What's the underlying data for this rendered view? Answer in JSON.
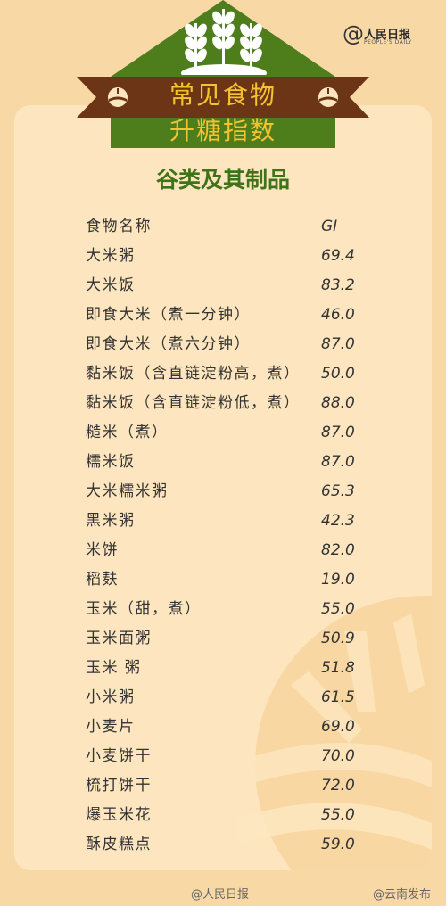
{
  "header": {
    "title_line1": "常见食物",
    "title_line2": "升糖指数"
  },
  "brand": {
    "at": "@",
    "name": "人民日报",
    "sub": "PEOPLE'S DAILY"
  },
  "section": {
    "title": "谷类及其制品"
  },
  "table": {
    "header_name": "食物名称",
    "header_gi": "GI",
    "rows": [
      {
        "name": "大米粥",
        "gi": "69.4"
      },
      {
        "name": "大米饭",
        "gi": "83.2"
      },
      {
        "name": "即食大米（煮一分钟）",
        "gi": "46.0"
      },
      {
        "name": "即食大米（煮六分钟）",
        "gi": "87.0"
      },
      {
        "name": "黏米饭（含直链淀粉高，煮）",
        "gi": "50.0"
      },
      {
        "name": "黏米饭（含直链淀粉低，煮）",
        "gi": "88.0"
      },
      {
        "name": "糙米（煮）",
        "gi": "87.0"
      },
      {
        "name": "糯米饭",
        "gi": "87.0"
      },
      {
        "name": "大米糯米粥",
        "gi": "65.3"
      },
      {
        "name": "黑米粥",
        "gi": "42.3"
      },
      {
        "name": "米饼",
        "gi": "82.0"
      },
      {
        "name": "稻麸",
        "gi": "19.0"
      },
      {
        "name": "玉米（甜，煮）",
        "gi": "55.0"
      },
      {
        "name": "玉米面粥",
        "gi": "50.9"
      },
      {
        "name": "玉米 粥",
        "gi": "51.8"
      },
      {
        "name": "小米粥",
        "gi": "61.5"
      },
      {
        "name": "小麦片",
        "gi": "69.0"
      },
      {
        "name": "小麦饼干",
        "gi": "70.0"
      },
      {
        "name": "梳打饼干",
        "gi": "72.0"
      },
      {
        "name": "爆玉米花",
        "gi": "55.0"
      },
      {
        "name": "酥皮糕点",
        "gi": "59.0"
      }
    ]
  },
  "footer": {
    "left": "@人民日报",
    "right": "@云南发布"
  },
  "colors": {
    "background": "#f8d9a6",
    "card": "#fde6bf",
    "green": "#4e7d1c",
    "ribbon": "#6b3516",
    "title_gold": "#f5c230",
    "section_green": "#3f7318"
  },
  "icons": [
    "wheat-icon",
    "sun-emblem-icon",
    "weibo-icon"
  ]
}
